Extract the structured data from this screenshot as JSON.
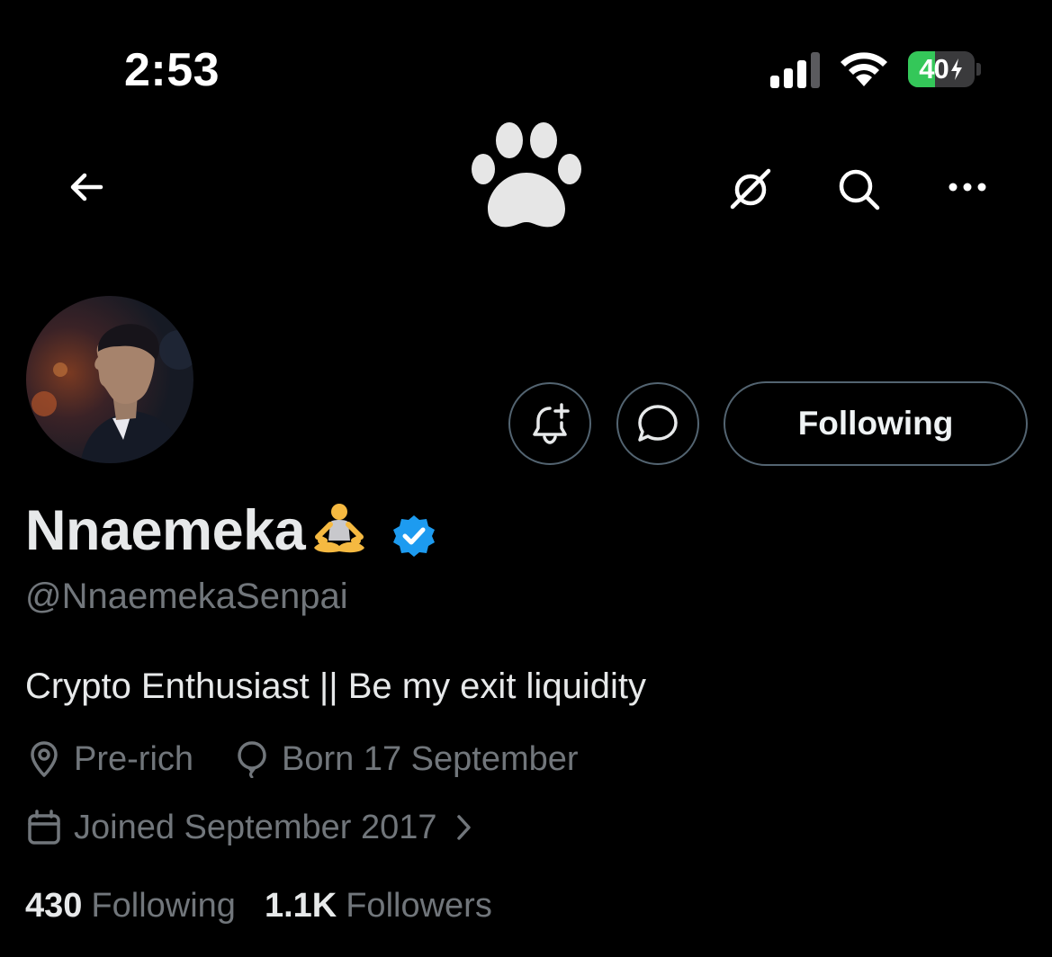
{
  "status_bar": {
    "time": "2:53",
    "battery_percent": 40,
    "battery_label": "40",
    "signal_bars": 3,
    "charging": true
  },
  "nav": {
    "back_icon": "arrow-left-icon",
    "logo_icon": "paw-icon",
    "actions": [
      "grok-icon",
      "search-icon",
      "more-icon"
    ]
  },
  "profile": {
    "display_name": "Nnaemeka",
    "name_emoji": "person-in-lotus-position",
    "verified": true,
    "handle": "@NnaemekaSenpai",
    "bio": "Crypto Enthusiast || Be my exit liquidity",
    "location": "Pre-rich",
    "birthday": "Born 17 September",
    "joined": "Joined September 2017",
    "following_count": "430",
    "following_label": "Following",
    "followers_count": "1.1K",
    "followers_label": "Followers"
  },
  "actions": {
    "follow_state_label": "Following",
    "notify_icon": "bell-plus-icon",
    "message_icon": "message-bubble-icon"
  },
  "colors": {
    "background": "#000000",
    "primary_text": "#e7e9ea",
    "secondary_text": "#71767b",
    "border": "#536471",
    "verified_blue": "#1d9bf0",
    "battery_green": "#34c759"
  }
}
